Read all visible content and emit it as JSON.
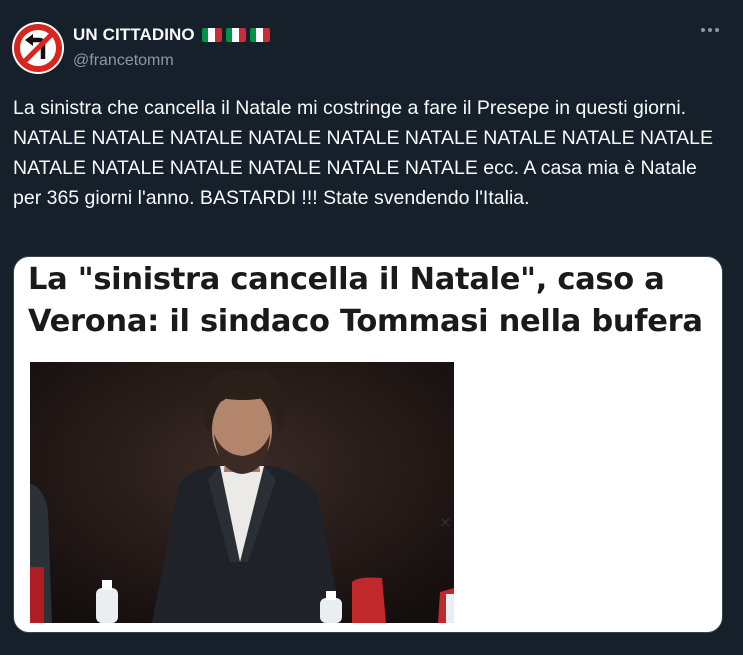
{
  "author": {
    "display_name": "UN CITTADINO",
    "handle": "@francetomm",
    "flag_count": 3,
    "flag_colors": [
      "#009246",
      "#ffffff",
      "#ce2b37"
    ]
  },
  "menu_icon": "more-dots-icon",
  "tweet_text": "La sinistra che cancella il Natale mi costringe a fare il Presepe in questi giorni. NATALE NATALE NATALE NATALE NATALE  NATALE NATALE NATALE NATALE NATALE NATALE NATALE NATALE NATALE NATALE ecc. A casa mia è Natale per 365 giorni l'anno. BASTARDI !!! State svendendo l'Italia.",
  "card": {
    "headline": "La \"sinistra cancella il Natale\", caso a Verona: il sindaco Tommasi nella bufera",
    "close_icon": "×"
  },
  "colors": {
    "background": "#15202b",
    "text": "#f7f9f9",
    "secondary": "#8b98a5"
  }
}
